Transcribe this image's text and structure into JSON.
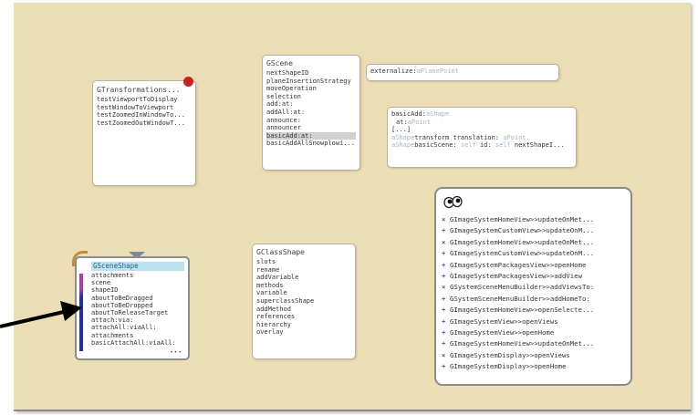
{
  "transformations": {
    "title": "GTransformations...",
    "items": [
      "testViewportToDisplay",
      "testWindowToViewport",
      "testZoomedInWindowTo...",
      "testZoomedOutWindowT..."
    ]
  },
  "gscene": {
    "title": "GScene",
    "items": [
      "nextShapeID",
      "planeInsertionStrategy",
      "moveOperation",
      "selection",
      "add:at:",
      "addAll:at:",
      "announce:",
      "announcer",
      "basicAdd:at:",
      "basicAddAllSnowplowi..."
    ],
    "selected_index": 8
  },
  "externalize": {
    "label": "externalize:",
    "arg": "aPlanePoint"
  },
  "basicadd": {
    "line1_a": "basicAdd:",
    "line1_b": "aShape",
    "line2_a": "at:",
    "line2_b": "aPoint",
    "line3": "[...]",
    "line4_a": "aShape",
    "line4_b": "transform translation: ",
    "line4_c": "aPoint.",
    "line5_a": "aShape",
    "line5_b": "basicScene: ",
    "line5_c": "self",
    "line5_d": " id: ",
    "line5_e": "self",
    "line5_f": " nextShapeI..."
  },
  "scene_shape": {
    "title": "GSceneShape",
    "items": [
      "attachments",
      "scene",
      "shapeID",
      "aboutToBeDragged",
      "aboutToBeDropped",
      "aboutToReleaseTarget",
      "attach:via:",
      "attachAll:viaAll:",
      "attachments",
      "basicAttachAll:viaAll:"
    ],
    "more": "•••"
  },
  "class_shape": {
    "title": "GClassShape",
    "items": [
      "slots",
      "rename",
      "addVariable",
      "methods",
      "variable",
      "superclassShape",
      "addMethod",
      "references",
      "hierarchy",
      "overlay"
    ]
  },
  "image_system": {
    "rows": [
      {
        "mark": "×",
        "color": "#3e5eaa",
        "text": "GImageSystemHomeView>>updateOnMet..."
      },
      {
        "mark": "+",
        "color": "#3e5eaa",
        "text": "GImageSystemCustomView>>updateOnM..."
      },
      {
        "mark": "×",
        "color": "#3e5eaa",
        "text": "GImageSystemHomeView>>updateOnMet..."
      },
      {
        "mark": "+",
        "color": "#3e5eaa",
        "text": "GImageSystemCustomView>>updateOnM..."
      },
      {
        "mark": "+",
        "color": "#3e5eaa",
        "text": "GImageSystemPackagesView>>openHome"
      },
      {
        "mark": "+",
        "color": "#3e5eaa",
        "text": "GImageSystemPackagesView>>addView"
      },
      {
        "mark": "×",
        "color": "#3e5eaa",
        "text": "GSystemSceneMenuBuilder>>addViewsTo:"
      },
      {
        "mark": "+",
        "color": "#3e5eaa",
        "text": "GSystemSceneMenuBuilder>>addHomeTo:"
      },
      {
        "mark": "+",
        "color": "#3e5eaa",
        "text": "GImageSystemHomeView>>openSelecte..."
      },
      {
        "mark": "+",
        "color": "#3e5eaa",
        "text": "GImageSystemView>>openViews"
      },
      {
        "mark": "+",
        "color": "#3e5eaa",
        "text": "GImageSystemView>>openHome"
      },
      {
        "mark": "+",
        "color": "#3e5eaa",
        "text": "GImageSystemHomeView>>updateOnMet..."
      },
      {
        "mark": "×",
        "color": "#3e5eaa",
        "text": "GImageSystemDisplay>>openViews"
      },
      {
        "mark": "+",
        "color": "#3e5eaa",
        "text": "GImageSystemDisplay>>openHome"
      }
    ]
  },
  "colors": {
    "canvas": "#ebdeb5",
    "highlight": "#d0d0d0",
    "arg_text": "#9fb7c8",
    "accent_red": "#cc1f1f",
    "header_cyan": "#b9e3ee"
  }
}
